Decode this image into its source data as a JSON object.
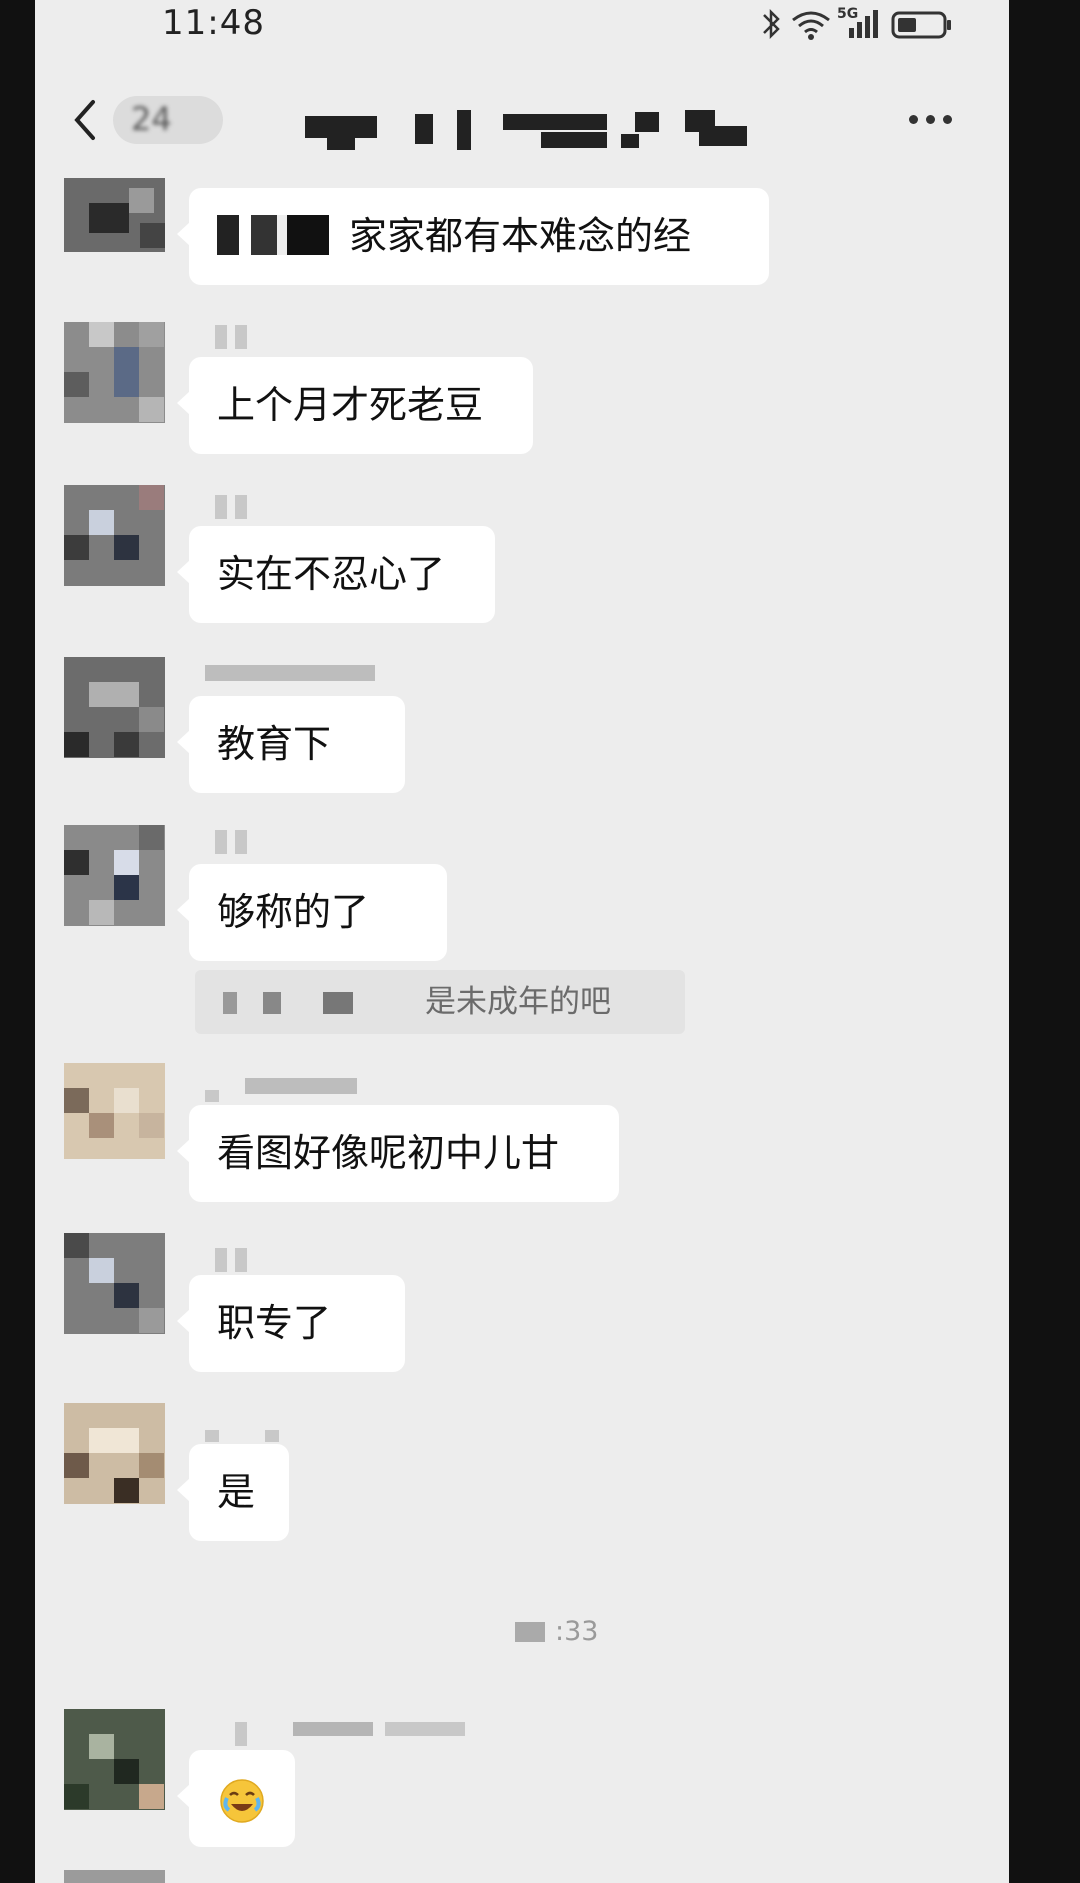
{
  "status_bar": {
    "time": "11:48",
    "network": "5G"
  },
  "nav": {
    "unread_count": "24",
    "title": ""
  },
  "messages": [
    {
      "text": "家家都有本难念的经"
    },
    {
      "text": "上个月才死老豆"
    },
    {
      "text": "实在不忍心了"
    },
    {
      "text": "教育下"
    },
    {
      "text": "够称的了"
    },
    {
      "text": "看图好像呢初中儿甘"
    },
    {
      "text": "职专了"
    },
    {
      "text": "是"
    },
    {
      "text": ""
    }
  ],
  "quote": {
    "text": "是未成年的吧"
  },
  "timestamp": ":33",
  "emoji": {
    "name": "crying-laughing-emoji-icon"
  },
  "colors": {
    "background": "#ededed",
    "bubble": "#ffffff"
  }
}
